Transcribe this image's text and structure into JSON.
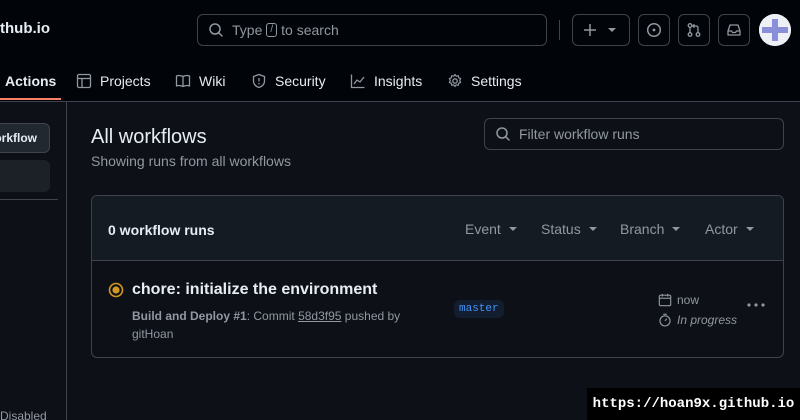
{
  "header": {
    "repo_name": "thub.io",
    "search": {
      "before": "Type",
      "key": "/",
      "after": "to search"
    },
    "avatar": "user-avatar"
  },
  "nav": {
    "tabs": [
      {
        "label": "Actions",
        "icon": "play-icon",
        "active": true
      },
      {
        "label": "Projects",
        "icon": "table-icon"
      },
      {
        "label": "Wiki",
        "icon": "book-icon"
      },
      {
        "label": "Security",
        "icon": "shield-icon"
      },
      {
        "label": "Insights",
        "icon": "graph-icon"
      },
      {
        "label": "Settings",
        "icon": "gear-icon"
      }
    ]
  },
  "sidebar": {
    "new_workflow": "orkflow",
    "disabled_label": "Disabled"
  },
  "main": {
    "title": "All workflows",
    "subtitle": "Showing runs from all workflows",
    "filter_placeholder": "Filter workflow runs",
    "runs": {
      "count_label": "0 workflow runs",
      "filters": [
        "Event",
        "Status",
        "Branch",
        "Actor"
      ],
      "items": [
        {
          "title": "chore: initialize the environment",
          "workflow": "Build and Deploy",
          "run_number": "#1",
          "commit_prefix": ": Commit",
          "commit": "58d3f95",
          "pushed_by": "pushed by",
          "actor": "gitHoan",
          "branch": "master",
          "time": "now",
          "status": "In progress"
        }
      ]
    }
  },
  "watermark": "https://hoan9x.github.io",
  "colors": {
    "accent": "#f78166",
    "in_progress": "#d29922",
    "branch": "#4493f8",
    "background": "#0d1117"
  }
}
